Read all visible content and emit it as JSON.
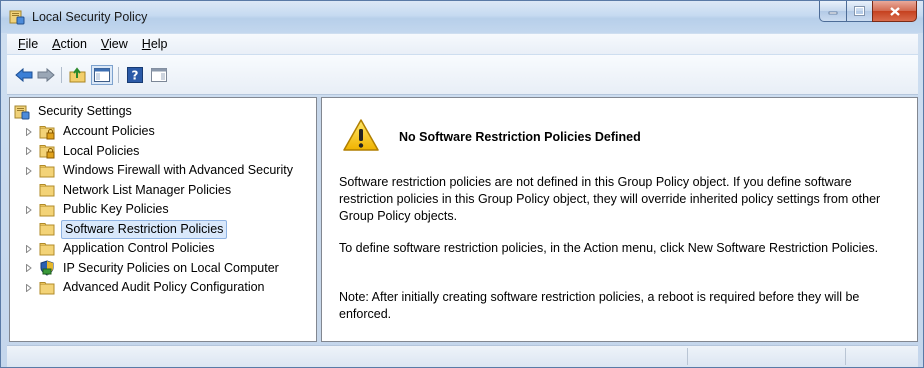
{
  "window": {
    "title": "Local Security Policy"
  },
  "menu": {
    "items": [
      {
        "accel": "F",
        "rest": "ile"
      },
      {
        "accel": "A",
        "rest": "ction"
      },
      {
        "accel": "V",
        "rest": "iew"
      },
      {
        "accel": "H",
        "rest": "elp"
      }
    ]
  },
  "toolbar": {
    "buttons": [
      "back-arrow-icon",
      "forward-arrow-icon",
      "up-folder-icon",
      "show-hide-console-tree-icon",
      "help-icon",
      "show-hide-action-pane-icon"
    ]
  },
  "tree": {
    "root": "Security Settings",
    "items": [
      {
        "label": "Account Policies",
        "icon": "folder-lock-icon",
        "expandable": true
      },
      {
        "label": "Local Policies",
        "icon": "folder-lock-icon",
        "expandable": true
      },
      {
        "label": "Windows Firewall with Advanced Security",
        "icon": "folder-icon",
        "expandable": true
      },
      {
        "label": "Network List Manager Policies",
        "icon": "folder-icon",
        "expandable": false
      },
      {
        "label": "Public Key Policies",
        "icon": "folder-icon",
        "expandable": true
      },
      {
        "label": "Software Restriction Policies",
        "icon": "folder-icon",
        "expandable": false,
        "selected": true
      },
      {
        "label": "Application Control Policies",
        "icon": "folder-icon",
        "expandable": true
      },
      {
        "label": "IP Security Policies on Local Computer",
        "icon": "ipsec-shield-icon",
        "expandable": true
      },
      {
        "label": "Advanced Audit Policy Configuration",
        "icon": "folder-icon",
        "expandable": true
      }
    ]
  },
  "content": {
    "heading": "No Software Restriction Policies Defined",
    "paragraphs": [
      "Software restriction policies are not defined in this Group Policy object. If you define software restriction policies in this Group Policy object, they will override inherited policy settings from other Group Policy objects.",
      "To define software restriction policies, in the Action menu, click New Software Restriction Policies.",
      "Note: After initially creating software restriction policies, a reboot is required before they will be enforced."
    ]
  },
  "colors": {
    "selection": "#d9e8fb",
    "selection_border": "#8fb3e3",
    "window_frame": "#c4d6ec"
  }
}
